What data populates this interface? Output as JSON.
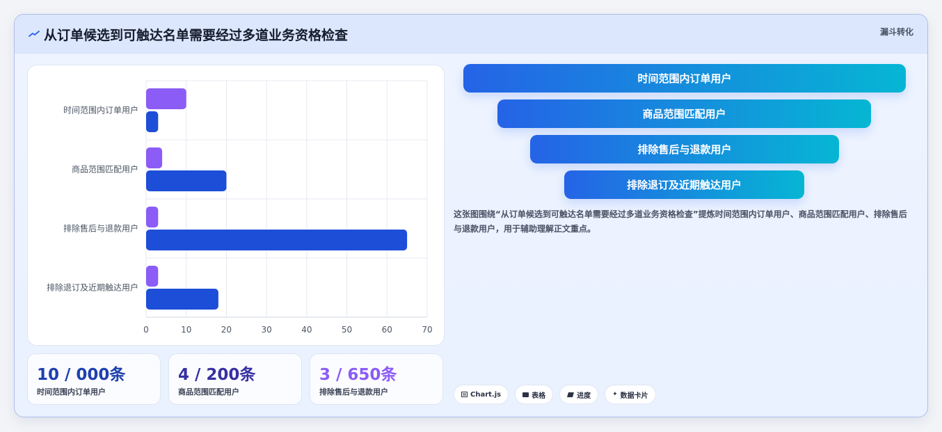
{
  "header": {
    "title": "从订单候选到可触达名单需要经过多道业务资格检查",
    "tag": "漏斗转化"
  },
  "colors": {
    "series_purple": "#8b5cf6",
    "series_blue": "#1d4ed8",
    "funnel_start": "#2563e6",
    "funnel_end": "#06b6d4"
  },
  "chart_data": {
    "type": "bar",
    "orientation": "horizontal",
    "categories": [
      "时间范围内订单用户",
      "商品范围匹配用户",
      "排除售后与退款用户",
      "排除退订及近期触达用户"
    ],
    "series": [
      {
        "values": [
          10,
          4,
          3,
          3
        ]
      },
      {
        "values": [
          3,
          20,
          65,
          18
        ]
      }
    ],
    "xlim": [
      0,
      70
    ],
    "xticks": [
      0,
      10,
      20,
      30,
      40,
      50,
      60,
      70
    ],
    "grid": true,
    "legend": "none"
  },
  "stats": [
    {
      "value": "10 / 000条",
      "label": "时间范围内订单用户"
    },
    {
      "value": "4 / 200条",
      "label": "商品范围匹配用户"
    },
    {
      "value": "3 / 650条",
      "label": "排除售后与退款用户"
    }
  ],
  "funnel": [
    {
      "label": "时间范围内订单用户"
    },
    {
      "label": "商品范围匹配用户"
    },
    {
      "label": "排除售后与退款用户"
    },
    {
      "label": "排除退订及近期触达用户"
    }
  ],
  "description": "这张图围绕“从订单候选到可触达名单需要经过多道业务资格检查”提炼时间范围内订单用户、商品范围匹配用户、排除售后与退款用户，用于辅助理解正文重点。",
  "chips": [
    {
      "icon": "chart-icon",
      "label": "Chart.js"
    },
    {
      "icon": "table-icon",
      "label": "表格"
    },
    {
      "icon": "progress-icon",
      "label": "进度"
    },
    {
      "icon": "sparkle-icon",
      "label": "数据卡片"
    }
  ]
}
